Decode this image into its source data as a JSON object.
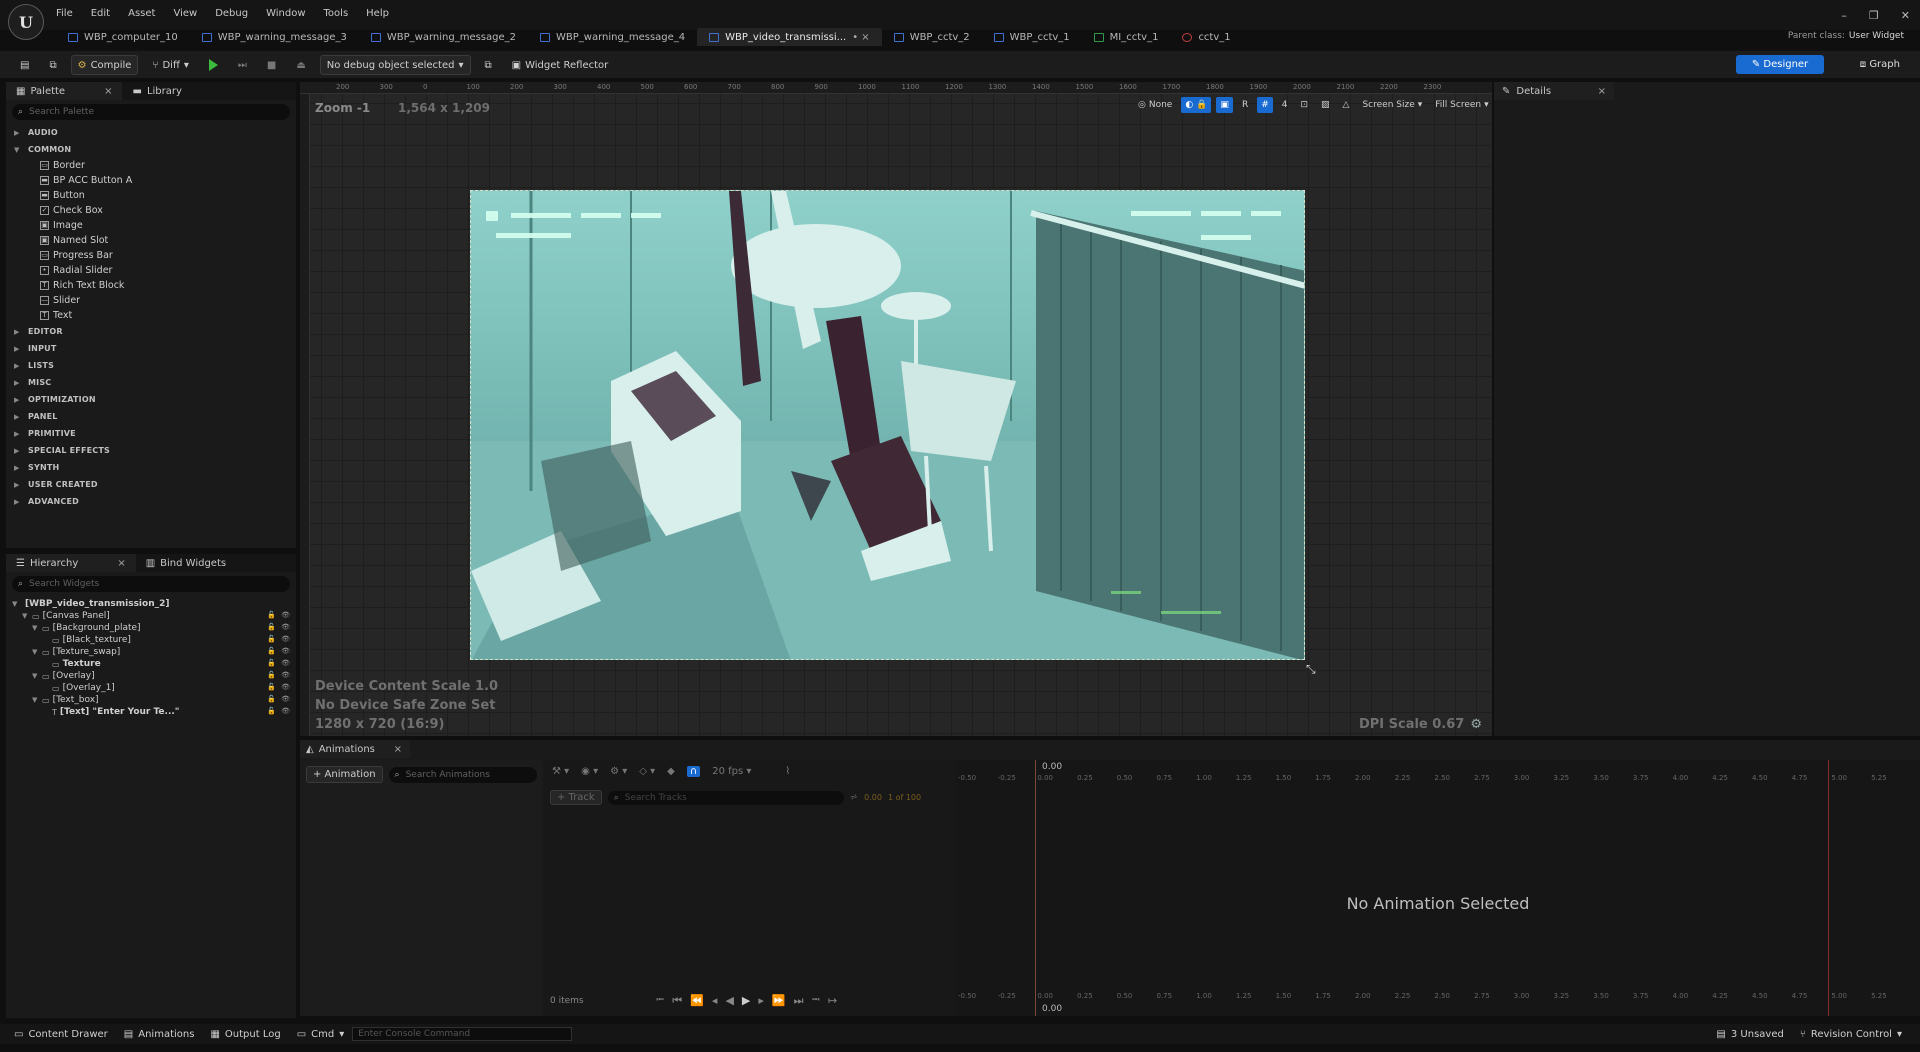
{
  "menu": {
    "logo": "U",
    "items": [
      "File",
      "Edit",
      "Asset",
      "View",
      "Debug",
      "Window",
      "Tools",
      "Help"
    ],
    "window_controls": [
      "–",
      "❐",
      "✕"
    ]
  },
  "tabs": [
    {
      "label": "WBP_computer_10",
      "type": "widget"
    },
    {
      "label": "WBP_warning_message_3",
      "type": "widget"
    },
    {
      "label": "WBP_warning_message_2",
      "type": "widget"
    },
    {
      "label": "WBP_warning_message_4",
      "type": "widget"
    },
    {
      "label": "WBP_video_transmissi...",
      "type": "widget",
      "active": true
    },
    {
      "label": "WBP_cctv_2",
      "type": "widget"
    },
    {
      "label": "WBP_cctv_1",
      "type": "widget"
    },
    {
      "label": "MI_cctv_1",
      "type": "material"
    },
    {
      "label": "cctv_1",
      "type": "texture"
    }
  ],
  "parent_class": {
    "label": "Parent class:",
    "value": "User Widget"
  },
  "toolbar": {
    "compile": "Compile",
    "diff": "Diff",
    "debug_object": "No debug object selected",
    "widget_reflector": "Widget Reflector",
    "designer": "Designer",
    "graph": "Graph"
  },
  "palette": {
    "tab_label": "Palette",
    "library_label": "Library",
    "search_placeholder": "Search Palette",
    "categories_top": [
      "AUDIO"
    ],
    "common_label": "COMMON",
    "common_items": [
      "Border",
      "BP ACC Button A",
      "Button",
      "Check Box",
      "Image",
      "Named Slot",
      "Progress Bar",
      "Radial Slider",
      "Rich Text Block",
      "Slider",
      "Text"
    ],
    "categories_bottom": [
      "EDITOR",
      "INPUT",
      "LISTS",
      "MISC",
      "OPTIMIZATION",
      "PANEL",
      "PRIMITIVE",
      "SPECIAL EFFECTS",
      "SYNTH",
      "USER CREATED",
      "ADVANCED"
    ]
  },
  "hierarchy": {
    "tab_label": "Hierarchy",
    "bind_label": "Bind Widgets",
    "search_placeholder": "Search Widgets",
    "rows": [
      "[WBP_video_transmission_2]",
      "[Canvas Panel]",
      "[Background_plate]",
      "[Black_texture]",
      "[Texture_swap]",
      "Texture",
      "[Overlay]",
      "[Overlay_1]",
      "[Text_box]",
      "[Text] \"Enter Your Te...\""
    ]
  },
  "viewport": {
    "zoom": "Zoom -1",
    "size": "1,564 x 1,209",
    "device_scale": "Device Content Scale 1.0",
    "safe_zone": "No Device Safe Zone Set",
    "resolution": "1280 x 720 (16:9)",
    "dpi": "DPI Scale 0.67",
    "tools": {
      "none": "None",
      "r": "R",
      "grid": "4",
      "screen_size": "Screen Size",
      "fill": "Fill Screen"
    },
    "ruler_ticks": [
      "200",
      "300",
      "0",
      "100",
      "200",
      "300",
      "400",
      "500",
      "600",
      "700",
      "800",
      "900",
      "1000",
      "1100",
      "1200",
      "1300",
      "1400",
      "1500",
      "1600",
      "1700",
      "1800",
      "1900",
      "2000",
      "2100",
      "2200",
      "2300"
    ]
  },
  "details": {
    "tab_label": "Details"
  },
  "animations": {
    "tab_label": "Animations",
    "add_button": "+ Animation",
    "search_placeholder": "Search Animations",
    "fps": "20 fps",
    "track_button": "+ Track",
    "search_tracks": "Search Tracks",
    "frame": "0.00",
    "frame_count": "1 of 100",
    "items_count": "0 items",
    "no_animation": "No Animation Selected",
    "playhead": "0.00",
    "timeline_ticks": [
      "-0.50",
      "-0.25",
      "0.00",
      "0.25",
      "0.50",
      "0.75",
      "1.00",
      "1.25",
      "1.50",
      "1.75",
      "2.00",
      "2.25",
      "2.50",
      "2.75",
      "3.00",
      "3.25",
      "3.50",
      "3.75",
      "4.00",
      "4.25",
      "4.50",
      "4.75",
      "5.00",
      "5.25"
    ]
  },
  "statusbar": {
    "content_drawer": "Content Drawer",
    "animations": "Animations",
    "output_log": "Output Log",
    "cmd": "Cmd",
    "console_placeholder": "Enter Console Command",
    "unsaved": "3 Unsaved",
    "revision": "Revision Control"
  },
  "colors": {
    "accent": "#1a6bd1",
    "cctv_tint": "#6fb0ad",
    "play": "#3dba3d"
  }
}
